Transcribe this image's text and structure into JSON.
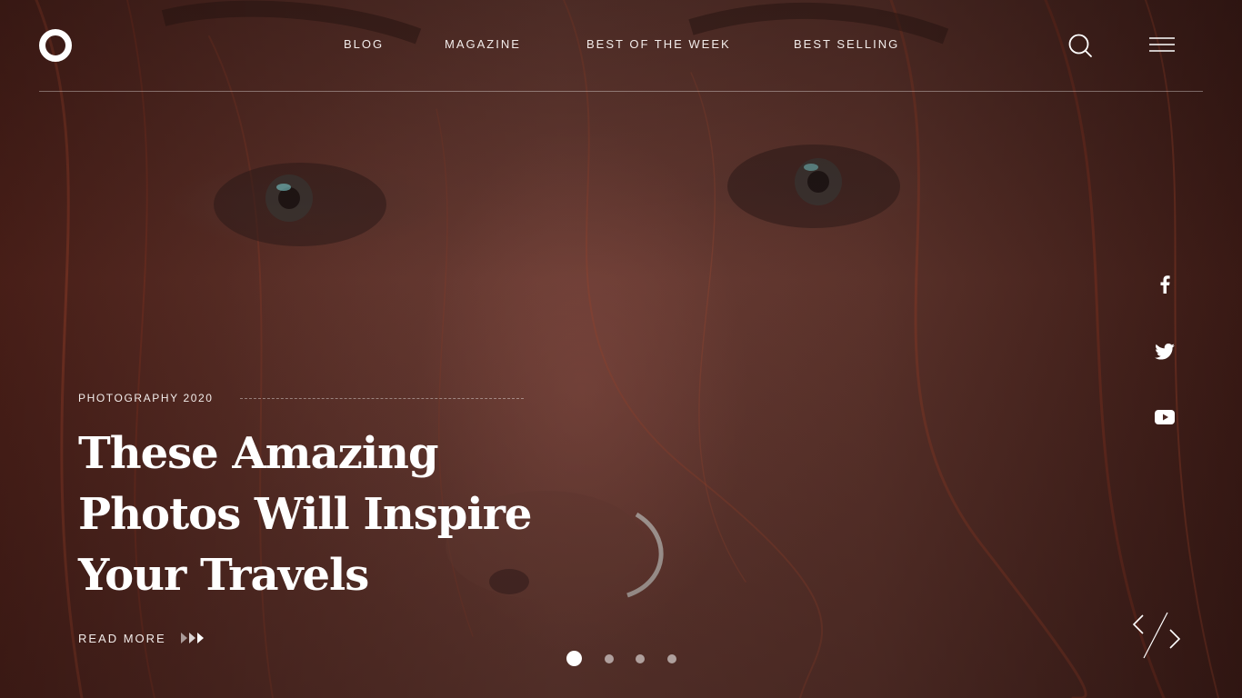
{
  "brand": {
    "logo": "ring-logo"
  },
  "nav": {
    "items": [
      {
        "label": "BLOG"
      },
      {
        "label": "MAGAZINE"
      },
      {
        "label": "BEST OF THE WEEK"
      },
      {
        "label": "BEST SELLING"
      }
    ]
  },
  "header": {
    "search_icon": "search-icon",
    "menu_icon": "hamburger-menu-icon"
  },
  "hero": {
    "kicker": "PHOTOGRAPHY 2020",
    "headline_lines": [
      "These Amazing",
      "Photos Will Inspire",
      "Your Travels"
    ],
    "read_more": "READ MORE"
  },
  "social": [
    "facebook-icon",
    "twitter-icon",
    "youtube-icon"
  ],
  "slider": {
    "slide_count": 4,
    "active_index": 0
  },
  "colors": {
    "text": "#ffffff",
    "nav_text": "#f2ecea",
    "background": "#5b2f27"
  }
}
